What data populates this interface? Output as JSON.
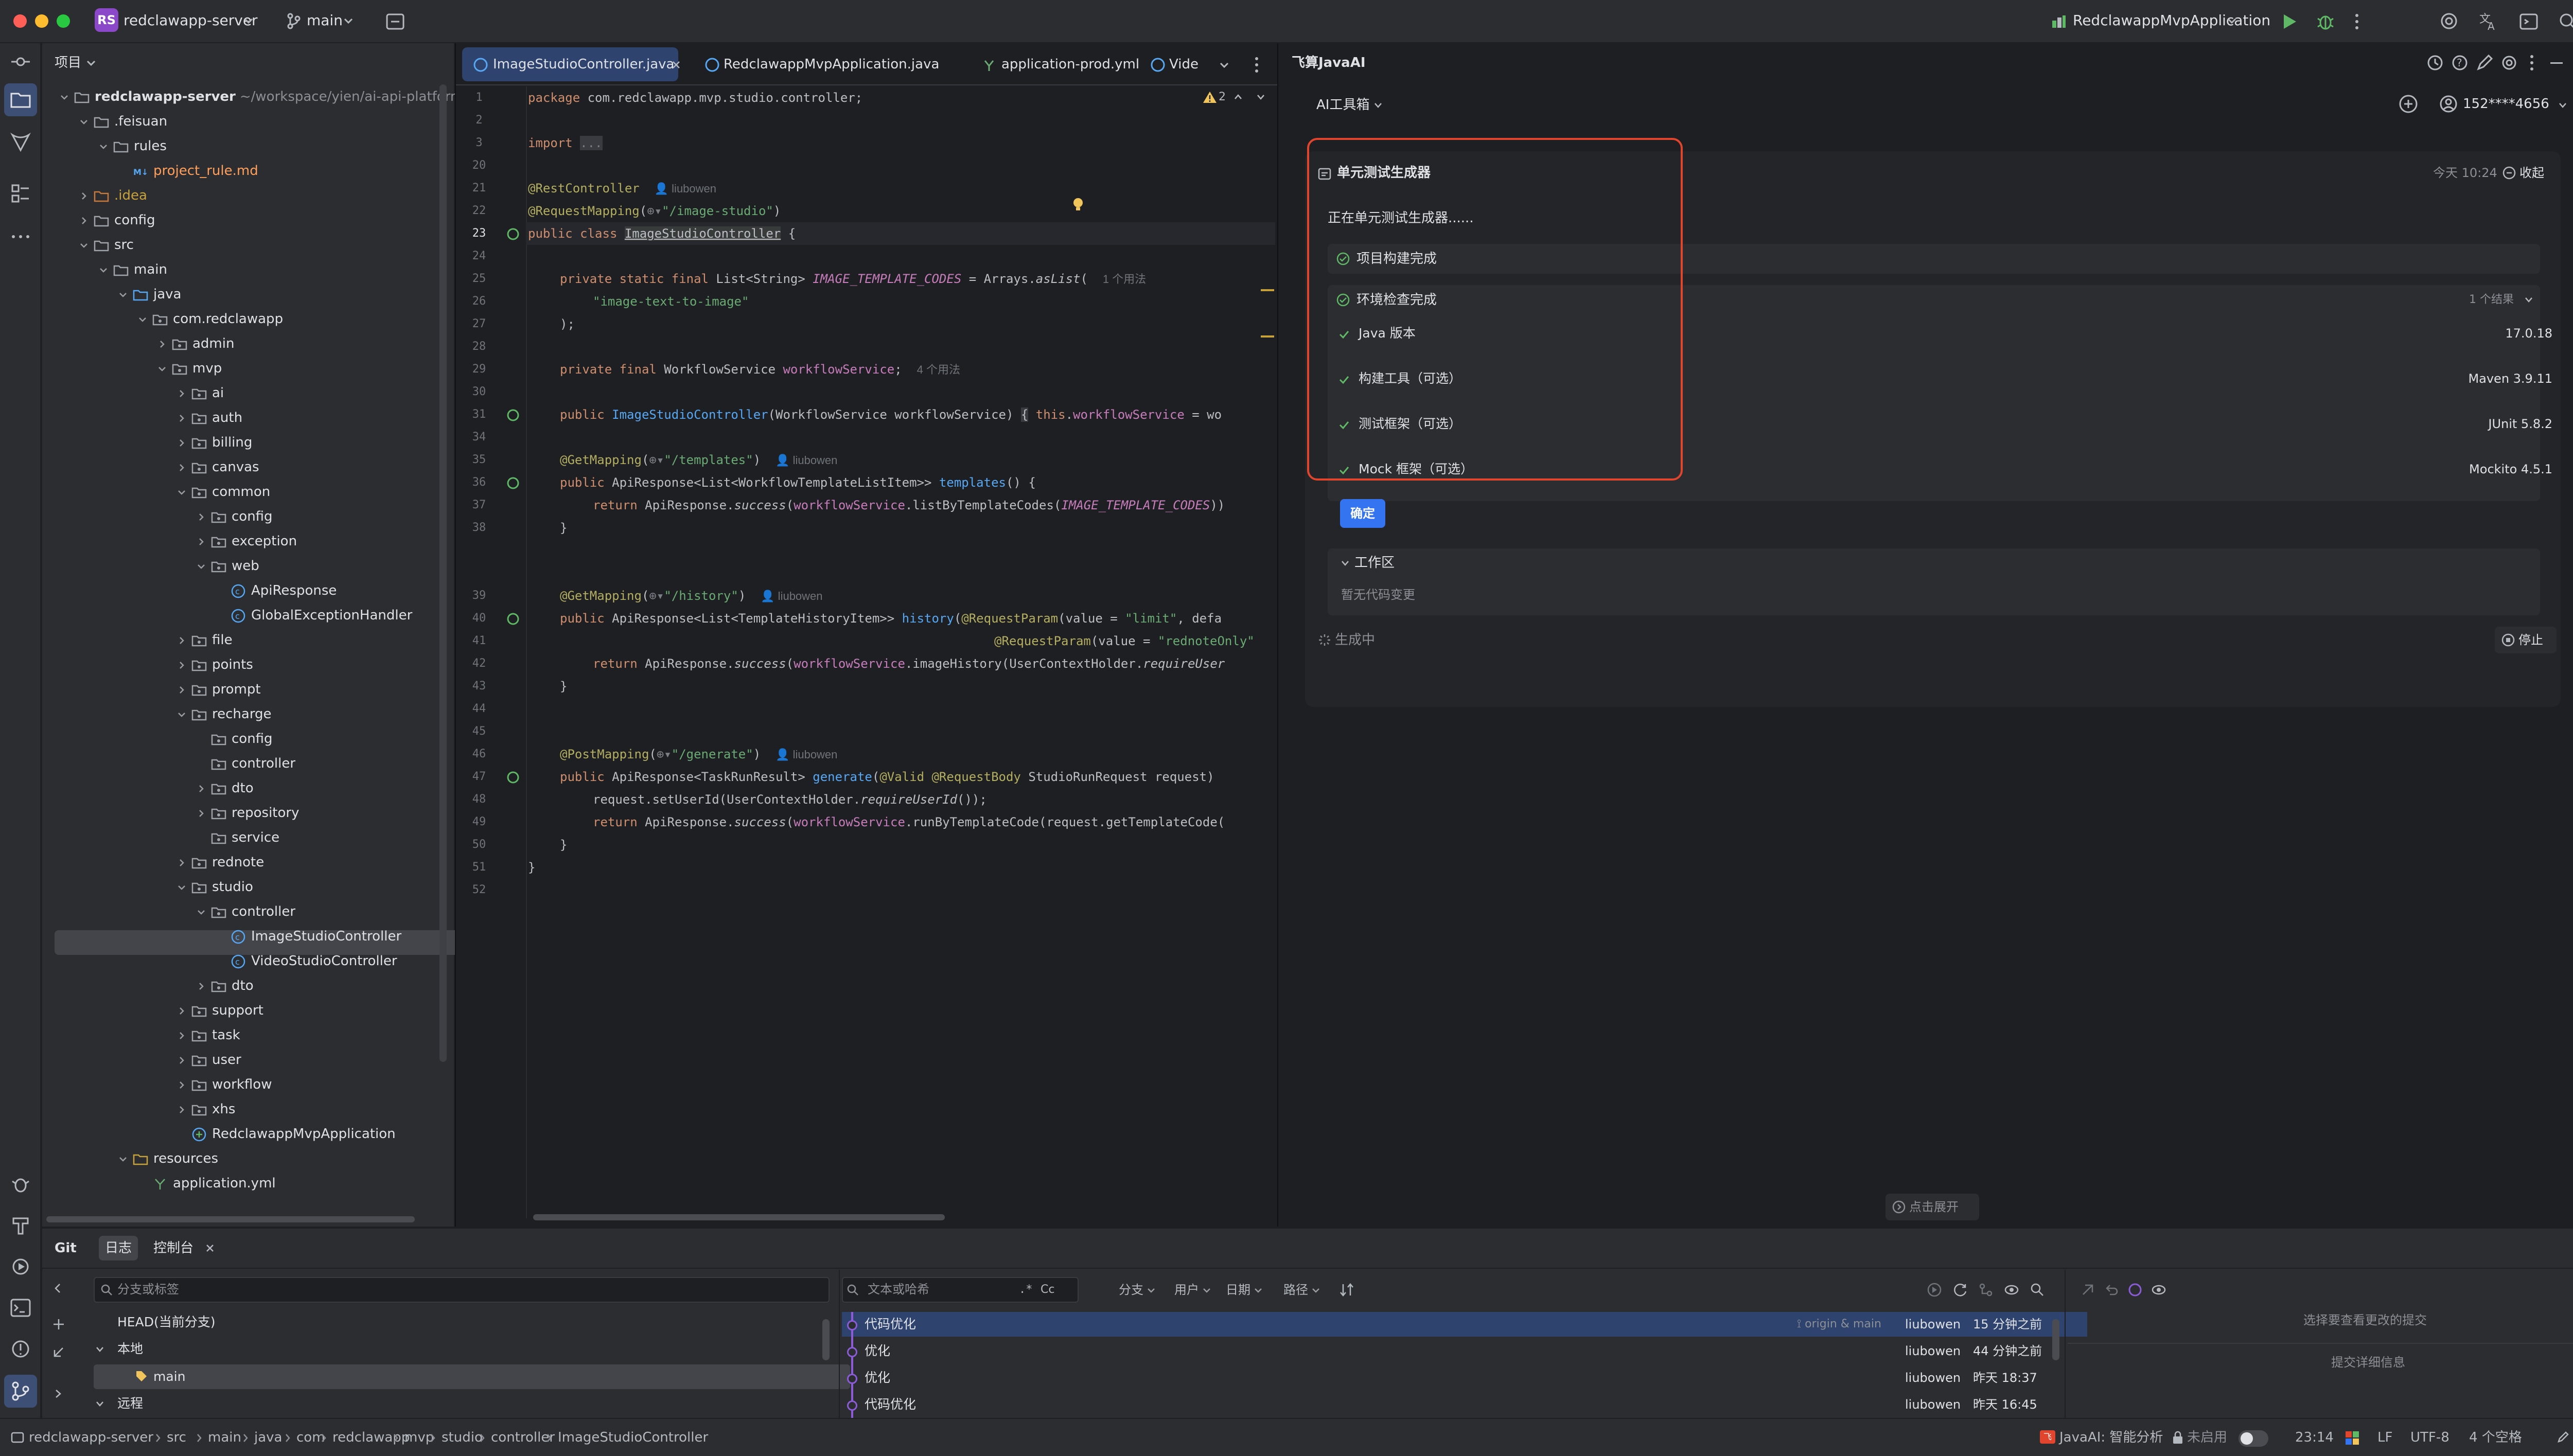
{
  "titlebar": {
    "project_badge": "RS",
    "project": "redclawapp-server",
    "branch": "main",
    "run_config": "RedclawappMvpApplication"
  },
  "project_panel": {
    "title": "项目"
  },
  "tree": [
    {
      "label": "redclawapp-server",
      "suffix": "~/workspace/yien/ai-api-platform/"
    },
    {
      "label": ".feisuan"
    },
    {
      "label": "rules"
    },
    {
      "label": "project_rule.md"
    },
    {
      "label": ".idea"
    },
    {
      "label": "config"
    },
    {
      "label": "src"
    },
    {
      "label": "main"
    },
    {
      "label": "java"
    },
    {
      "label": "com.redclawapp"
    },
    {
      "label": "admin"
    },
    {
      "label": "mvp"
    },
    {
      "label": "ai"
    },
    {
      "label": "auth"
    },
    {
      "label": "billing"
    },
    {
      "label": "canvas"
    },
    {
      "label": "common"
    },
    {
      "label": "config"
    },
    {
      "label": "exception"
    },
    {
      "label": "web"
    },
    {
      "label": "ApiResponse"
    },
    {
      "label": "GlobalExceptionHandler"
    },
    {
      "label": "file"
    },
    {
      "label": "points"
    },
    {
      "label": "prompt"
    },
    {
      "label": "recharge"
    },
    {
      "label": "config"
    },
    {
      "label": "controller"
    },
    {
      "label": "dto"
    },
    {
      "label": "repository"
    },
    {
      "label": "service"
    },
    {
      "label": "rednote"
    },
    {
      "label": "studio"
    },
    {
      "label": "controller"
    },
    {
      "label": "ImageStudioController"
    },
    {
      "label": "VideoStudioController"
    },
    {
      "label": "dto"
    },
    {
      "label": "support"
    },
    {
      "label": "task"
    },
    {
      "label": "user"
    },
    {
      "label": "workflow"
    },
    {
      "label": "xhs"
    },
    {
      "label": "RedclawappMvpApplication"
    },
    {
      "label": "resources"
    },
    {
      "label": "application.yml"
    }
  ],
  "editor": {
    "tabs": [
      "ImageStudioController.java",
      "RedclawappMvpApplication.java",
      "application-prod.yml",
      "Vide"
    ],
    "warnings": "2",
    "author": "liubowen",
    "usages_1": "1 个用法",
    "usages_4": "4 个用法",
    "line_numbers": [
      "1",
      "2",
      "3",
      "20",
      "21",
      "22",
      "23",
      "24",
      "25",
      "26",
      "27",
      "28",
      "29",
      "30",
      "31",
      "34",
      "35",
      "36",
      "37",
      "38",
      "39",
      "40",
      "41",
      "42",
      "43",
      "44",
      "45",
      "46",
      "47",
      "48",
      "49",
      "50",
      "51",
      "52"
    ]
  },
  "ai_panel": {
    "title": "飞算JavaAI",
    "toolbox": "AI工具箱",
    "user": "152****4656",
    "card_title": "单元测试生成器",
    "time": "今天 10:24",
    "collapse": "收起",
    "status": "正在单元测试生成器......",
    "step1": "项目构建完成",
    "step2": "环境检查完成",
    "result_count": "1 个结果",
    "checks": [
      {
        "label": "Java 版本",
        "value": "17.0.18"
      },
      {
        "label": "构建工具（可选）",
        "value": "Maven 3.9.11"
      },
      {
        "label": "测试框架（可选）",
        "value": "JUnit 5.8.2"
      },
      {
        "label": "Mock 框架（可选）",
        "value": "Mockito 4.5.1"
      }
    ],
    "confirm": "确定",
    "workspace": "工作区",
    "no_changes": "暂无代码变更",
    "generating": "生成中",
    "stop": "停止",
    "expand": "点击展开"
  },
  "bottom": {
    "tabs": [
      "Git",
      "日志",
      "控制台"
    ],
    "branch_filter_placeholder": "分支或标签",
    "head": "HEAD(当前分支)",
    "local": "本地",
    "main": "main",
    "remote": "远程",
    "search_placeholder": "文本或哈希",
    "regex": ".*",
    "case": "Cc",
    "filters": [
      "分支",
      "用户",
      "日期",
      "路径"
    ],
    "commits": [
      {
        "msg": "代码优化",
        "ref": "origin & main",
        "author": "liubowen",
        "time": "15 分钟之前"
      },
      {
        "msg": "优化",
        "ref": "",
        "author": "liubowen",
        "time": "44 分钟之前"
      },
      {
        "msg": "优化",
        "ref": "",
        "author": "liubowen",
        "time": "昨天 18:37"
      },
      {
        "msg": "代码优化",
        "ref": "",
        "author": "liubowen",
        "time": "昨天 16:45"
      }
    ],
    "select_commit": "选择要查看更改的提交",
    "commit_details": "提交详细信息"
  },
  "statusbar": {
    "breadcrumb": [
      "redclawapp-server",
      "src",
      "main",
      "java",
      "com",
      "redclawapp",
      "mvp",
      "studio",
      "controller",
      "ImageStudioController"
    ],
    "javaai": "JavaAI: 智能分析",
    "disabled": "未启用",
    "time": "23:14",
    "lf": "LF",
    "encoding": "UTF-8",
    "indent": "4 个空格"
  },
  "colors": {
    "accent": "#3574f0",
    "highlight_box": "#e2452d",
    "success": "#5fb865"
  }
}
